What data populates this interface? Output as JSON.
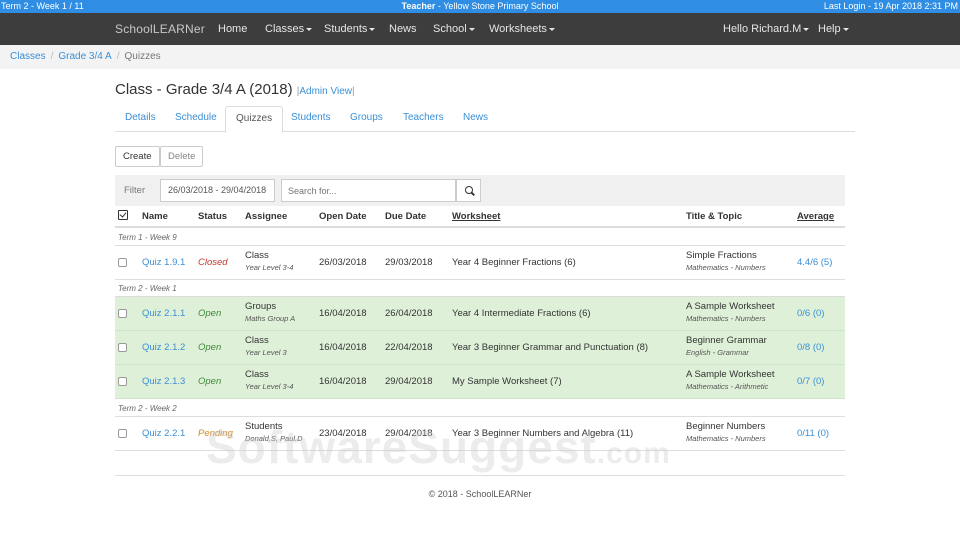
{
  "topbar": {
    "term": "Term 2 - Week 1 / 11",
    "role": "Teacher",
    "school": " - Yellow Stone Primary School",
    "last_login": "Last Login - 19 Apr 2018 2:31 PM"
  },
  "nav": {
    "brand": "SchoolLEARNer",
    "home": "Home",
    "classes": "Classes",
    "students": "Students",
    "news": "News",
    "school": "School",
    "worksheets": "Worksheets",
    "user": "Hello Richard.M",
    "help": "Help"
  },
  "breadcrumb": {
    "items": [
      "Classes",
      "Grade 3/4 A"
    ],
    "active": "Quizzes",
    "separator": "/"
  },
  "page": {
    "title": "Class - Grade 3/4 A (2018)",
    "admin_view": "Admin View",
    "pipe": "|"
  },
  "tabs": [
    "Details",
    "Schedule",
    "Quizzes",
    "Students",
    "Groups",
    "Teachers",
    "News"
  ],
  "toolbar": {
    "create": "Create",
    "delete": "Delete"
  },
  "filter": {
    "label": "Filter",
    "date_range": "26/03/2018 - 29/04/2018",
    "search_placeholder": "Search for..."
  },
  "table": {
    "headers": {
      "name": "Name",
      "status": "Status",
      "assignee": "Assignee",
      "open_date": "Open Date",
      "due_date": "Due Date",
      "worksheet": "Worksheet",
      "title_topic": "Title & Topic",
      "average": "Average"
    },
    "groups": [
      "Term 1 - Week 9",
      "Term 2 - Week 1",
      "Term 2 - Week 2"
    ],
    "rows": [
      {
        "name": "Quiz 1.9.1",
        "status": "Closed",
        "assignee": "Class",
        "assignee_sub": "Year Level 3-4",
        "open": "26/03/2018",
        "due": "29/03/2018",
        "worksheet": "Year 4 Beginner Fractions (6)",
        "title": "Simple Fractions",
        "topic": "Mathematics - Numbers",
        "average": "4.4/6 (5)"
      },
      {
        "name": "Quiz 2.1.1",
        "status": "Open",
        "assignee": "Groups",
        "assignee_sub": "Maths Group A",
        "open": "16/04/2018",
        "due": "26/04/2018",
        "worksheet": "Year 4 Intermediate Fractions (6)",
        "title": "A Sample Worksheet",
        "topic": "Mathematics - Numbers",
        "average": "0/6 (0)"
      },
      {
        "name": "Quiz 2.1.2",
        "status": "Open",
        "assignee": "Class",
        "assignee_sub": "Year Level 3",
        "open": "16/04/2018",
        "due": "22/04/2018",
        "worksheet": "Year 3 Beginner Grammar and Punctuation (8)",
        "title": "Beginner Grammar",
        "topic": "English - Grammar",
        "average": "0/8 (0)"
      },
      {
        "name": "Quiz 2.1.3",
        "status": "Open",
        "assignee": "Class",
        "assignee_sub": "Year Level 3-4",
        "open": "16/04/2018",
        "due": "29/04/2018",
        "worksheet": "My Sample Worksheet (7)",
        "title": "A Sample Worksheet",
        "topic": "Mathematics - Arithmetic",
        "average": "0/7 (0)"
      },
      {
        "name": "Quiz 2.2.1",
        "status": "Pending",
        "assignee": "Students",
        "assignee_sub": "Donald.S, Paul.D",
        "open": "23/04/2018",
        "due": "29/04/2018",
        "worksheet": "Year 3 Beginner Numbers and Algebra (11)",
        "title": "Beginner Numbers",
        "topic": "Mathematics - Numbers",
        "average": "0/11 (0)"
      }
    ]
  },
  "footer": "© 2018 - SchoolLEARNer",
  "watermark": {
    "main": "SoftwareSuggest",
    "suffix": ".com"
  },
  "colors": {
    "topbar": "#2f8de4",
    "navbar": "#3d3d3d",
    "link": "#3a8fd6",
    "open_row": "#dff0d8",
    "status_closed": "#c0392b",
    "status_open": "#3c8a3c",
    "status_pending": "#d48a1a"
  }
}
